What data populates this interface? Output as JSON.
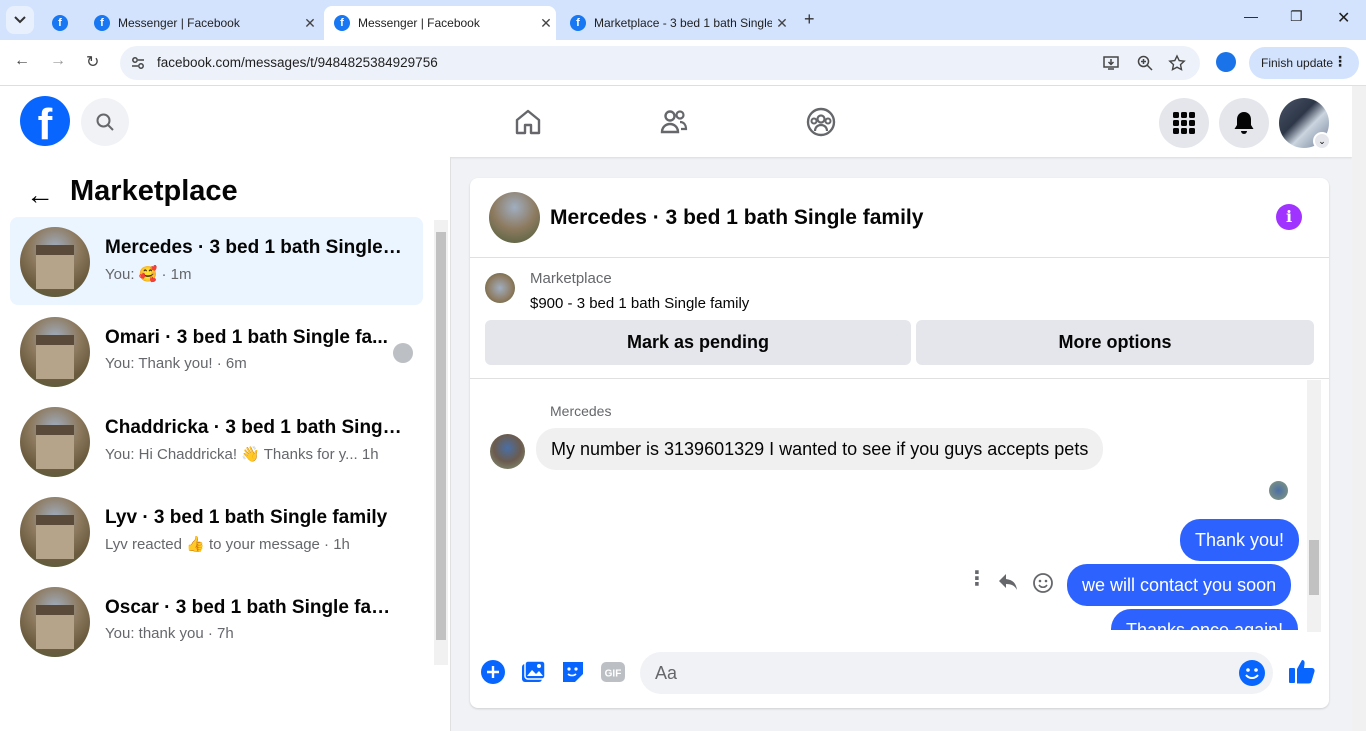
{
  "browser": {
    "tabs": [
      {
        "title": "Messenger | Facebook",
        "active": false
      },
      {
        "title": "Messenger | Facebook",
        "active": true
      },
      {
        "title": "Marketplace - 3 bed 1 bath Single",
        "active": false
      }
    ],
    "url": "facebook.com/messages/t/9484825384929756",
    "finish_update": "Finish update"
  },
  "sidebar": {
    "title": "Marketplace",
    "conversations": [
      {
        "name": "Mercedes · 3 bed 1 bath Single f...",
        "preview": "You: 🥰 · 1m",
        "selected": true
      },
      {
        "name": "Omari · 3 bed 1 bath Single fa...",
        "preview": "You: Thank you! · 6m",
        "selected": false
      },
      {
        "name": "Chaddricka · 3 bed 1 bath Single ...",
        "preview": "You: Hi Chaddricka! 👋 Thanks for y... 1h",
        "selected": false
      },
      {
        "name": "Lyv · 3 bed 1 bath Single family",
        "preview": "Lyv reacted 👍 to your message · 1h",
        "selected": false
      },
      {
        "name": "Oscar · 3 bed 1 bath Single family",
        "preview": "You: thank you · 7h",
        "selected": false
      }
    ]
  },
  "chat": {
    "title": "Mercedes · 3 bed 1 bath Single family",
    "marketplace_label": "Marketplace",
    "listing": "$900 - 3 bed 1 bath Single family",
    "mark_pending": "Mark as pending",
    "more_options": "More options",
    "sender": "Mercedes",
    "messages": [
      {
        "text": "My number is 3139601329 I wanted to see if you guys accepts pets",
        "from": "them"
      },
      {
        "text": "Thank you!",
        "from": "me"
      },
      {
        "text": "we will contact you soon",
        "from": "me"
      },
      {
        "text": "Thanks once again!",
        "from": "me"
      }
    ],
    "composer_placeholder": "Aa"
  },
  "colors": {
    "brand": "#0866ff",
    "outgoing": "#2d62ff",
    "info": "#a033ff"
  }
}
